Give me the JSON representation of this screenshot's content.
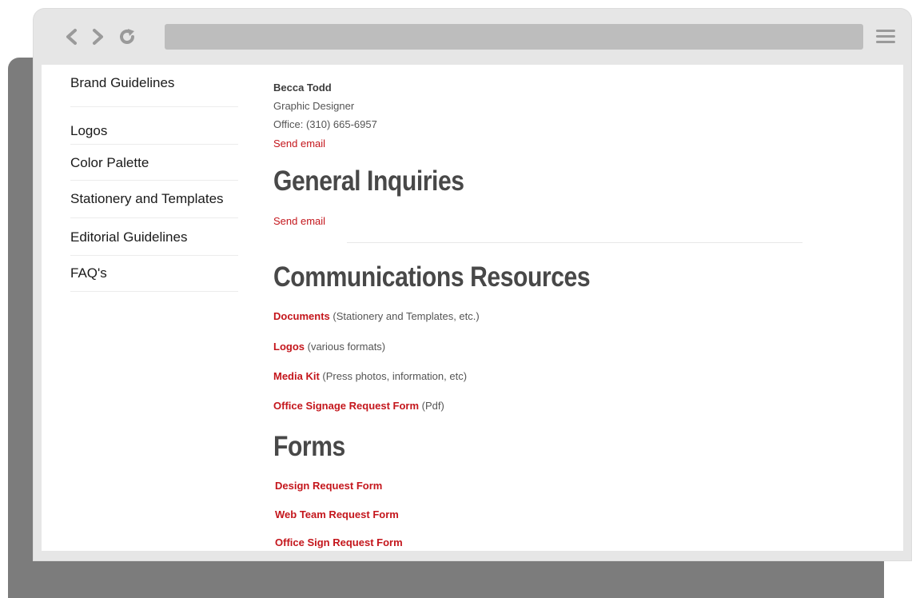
{
  "browser": {
    "nav": {
      "back_icon": "chevron-left",
      "forward_icon": "chevron-right",
      "reload_icon": "reload",
      "menu_icon": "hamburger-menu"
    },
    "address": ""
  },
  "sidebar": {
    "items": [
      {
        "label": "Brand Guidelines"
      },
      {
        "label": "Logos"
      },
      {
        "label": "Color Palette"
      },
      {
        "label": "Stationery and Templates"
      },
      {
        "label": "Editorial Guidelines"
      },
      {
        "label": "FAQ's"
      }
    ]
  },
  "contact": {
    "name": "Becca Todd",
    "title": "Graphic Designer",
    "phone": "Office: (310) 665-6957",
    "email_link": "Send email"
  },
  "general_inquiries": {
    "heading": "General Inquiries",
    "email_link": "Send email"
  },
  "communications": {
    "heading": "Communications Resources",
    "items": [
      {
        "link": "Documents",
        "note": " (Stationery and Templates, etc.)"
      },
      {
        "link": "Logos",
        "note": " (various formats)"
      },
      {
        "link": "Media Kit",
        "note": " (Press photos, information, etc)"
      },
      {
        "link": "Office Signage Request Form",
        "note": " (Pdf)"
      }
    ]
  },
  "forms": {
    "heading": "Forms",
    "items": [
      {
        "label": "Design Request Form"
      },
      {
        "label": "Web Team Request Form"
      },
      {
        "label": "Office Sign Request Form"
      }
    ]
  },
  "colors": {
    "link_red": "#c4161c",
    "heading_gray": "#484848",
    "chrome_gray": "#e6e6e6",
    "address_bar_gray": "#bdbdbd",
    "backdrop_gray": "#7c7c7c"
  }
}
